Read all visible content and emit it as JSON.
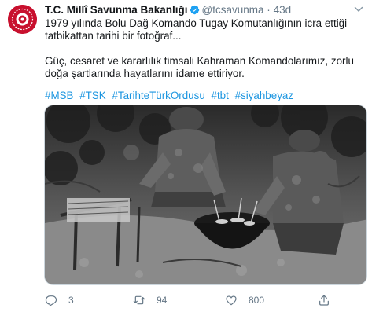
{
  "tweet": {
    "author_name": "T.C. Millî Savunma Bakanlığı",
    "handle": "@tcsavunma",
    "separator": "·",
    "time": "43d",
    "text_line1": "1979 yılında Bolu Dağ Komando Tugay Komutanlığının icra ettiği tatbikattan tarihi bir fotoğraf...",
    "text_line2": "Güç, cesaret ve kararlılık timsali Kahraman Komandolarımız, zorlu doğa şartlarında hayatlarını idame ettiriyor.",
    "hashtags": [
      "#MSB",
      "#TSK",
      "#TarihteTürkOrdusu",
      "#tbt",
      "#siyahbeyaz"
    ]
  },
  "actions": {
    "reply_count": "3",
    "retweet_count": "94",
    "like_count": "800"
  },
  "colors": {
    "link": "#1b95e0",
    "verified": "#1da1f2",
    "brand_red": "#c8102e",
    "muted": "#657786"
  },
  "icons": [
    "verified-badge-icon",
    "chevron-down-icon",
    "reply-icon",
    "retweet-icon",
    "like-icon",
    "share-icon"
  ]
}
